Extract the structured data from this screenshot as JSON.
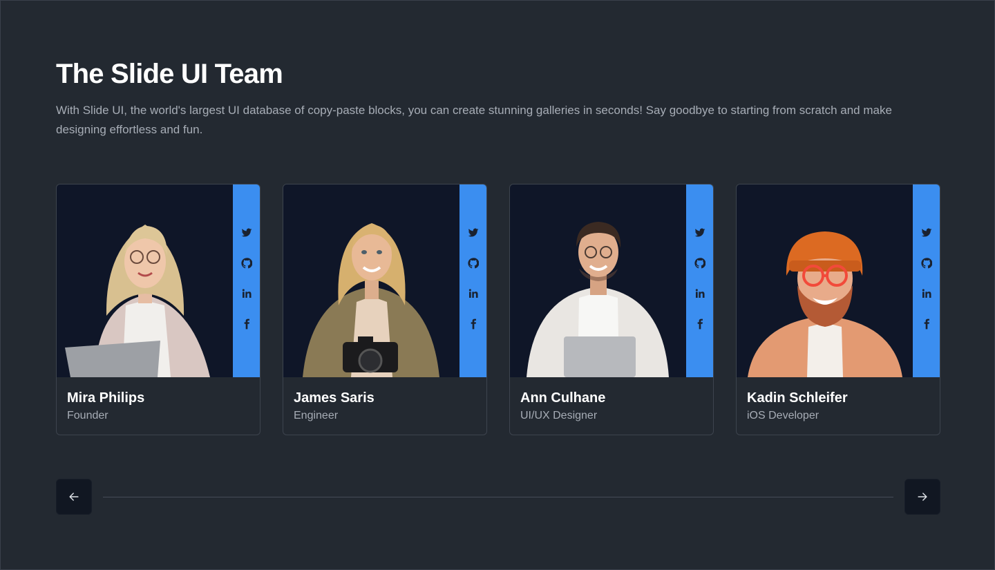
{
  "section": {
    "title": "The Slide UI Team",
    "description": "With Slide UI, the world's largest UI database of copy-paste blocks, you can create stunning galleries in seconds! Say goodbye to starting from scratch and make designing effortless and fun."
  },
  "members": [
    {
      "name": "Mira Philips",
      "role": "Founder"
    },
    {
      "name": "James Saris",
      "role": "Engineer"
    },
    {
      "name": "Ann Culhane",
      "role": "UI/UX Designer"
    },
    {
      "name": "Kadin Schleifer",
      "role": "iOS Developer"
    }
  ],
  "social_icons": [
    "twitter-icon",
    "github-icon",
    "linkedin-icon",
    "facebook-icon"
  ],
  "navigation": {
    "prev_icon": "arrow-left-icon",
    "next_icon": "arrow-right-icon"
  },
  "colors": {
    "background": "#232931",
    "photo_background": "#0f1628",
    "social_bar": "#3b8ef0",
    "nav_button": "#111722"
  }
}
